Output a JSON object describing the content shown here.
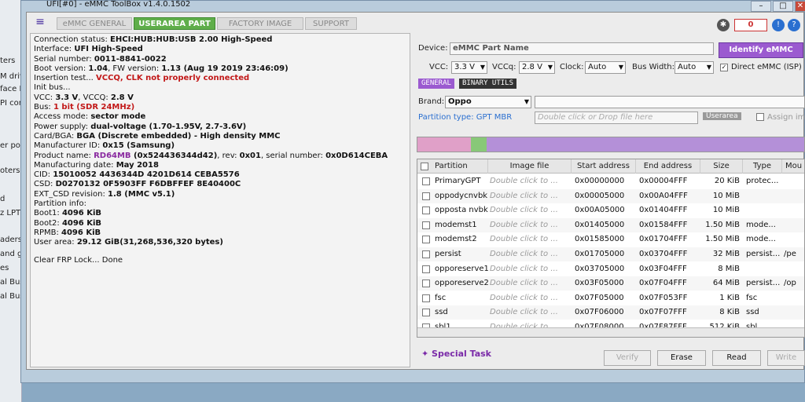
{
  "window": {
    "title": "UFI[#0] - eMMC ToolBox v1.4.0.1502",
    "controls": [
      "–",
      "□",
      "✕"
    ]
  },
  "background_fragments": [
    "ters",
    "M driv",
    "face D",
    "PI con",
    "er poi",
    "oters",
    "d",
    "z LPT)",
    "aders",
    "and g",
    "es",
    "al Bus",
    "al Bus"
  ],
  "tabs": [
    "eMMC GENERAL",
    "USERAREA PART",
    "FACTORY IMAGE",
    "SUPPORT"
  ],
  "counter": "0",
  "log": {
    "connection_status": {
      "label": "Connection status: ",
      "value": "EHCI:HUB:HUB:USB 2.00 High-Speed"
    },
    "interface": {
      "label": "Interface: ",
      "value": "UFI High-Speed"
    },
    "serial": {
      "label": "Serial number: ",
      "value": "0011-8841-0022"
    },
    "boot_version": {
      "label": "Boot version: ",
      "value": "1.04",
      "fw_label": ", FW version: ",
      "fw_value": "1.13 (Aug 19 2019 23:46:09)"
    },
    "insertion": {
      "label": "Insertion test... ",
      "value": "VCCQ, CLK not properly connected"
    },
    "init_bus": "Init bus...",
    "vcc": {
      "label": "VCC: ",
      "value": "3.3 V",
      "vccq_label": ", VCCQ: ",
      "vccq_value": "2.8 V"
    },
    "bus": {
      "label": "Bus: ",
      "value": "1 bit (SDR 24MHz)"
    },
    "access_mode": {
      "label": "Access mode: ",
      "value": "sector mode"
    },
    "power_supply": {
      "label": "Power supply: ",
      "value": "dual-voltage (1.70-1.95V, 2.7-3.6V)"
    },
    "card_bga": {
      "label": "Card/BGA: ",
      "value": "BGA (Discrete embedded) - High density MMC"
    },
    "manufacturer": {
      "label": "Manufacturer ID: ",
      "value": "0x15 (Samsung)"
    },
    "product": {
      "label": "Product name: ",
      "value": "RD64MB",
      "value2": " (0x524436344d42)",
      "rev_label": ", rev: ",
      "rev_value": "0x01",
      "sn_label": ", serial number: ",
      "sn_value": "0x0D614CEBA"
    },
    "mfg_date": {
      "label": "Manufacturing date: ",
      "value": "May 2018"
    },
    "cid": {
      "label": "CID: ",
      "value": "15010052 4436344D 4201D614 CEBA5576"
    },
    "csd": {
      "label": "CSD: ",
      "value": "D0270132 0F5903FF F6DBFFEF 8E40400C"
    },
    "ext_csd": {
      "label": "EXT_CSD revision: ",
      "value": "1.8 (MMC v5.1)"
    },
    "partition_info": "Partition info:",
    "boot1": {
      "label": "Boot1: ",
      "value": "4096 KiB"
    },
    "boot2": {
      "label": "Boot2: ",
      "value": "4096 KiB"
    },
    "rpmb": {
      "label": "RPMB: ",
      "value": "4096 KiB"
    },
    "user_area": {
      "label": "User area: ",
      "value": "29.12 GiB(31,268,536,320 bytes)"
    },
    "frp": "Clear FRP Lock... Done"
  },
  "device": {
    "label": "Device:",
    "value": "eMMC Part Name",
    "identify_button": "Identify eMMC",
    "vcc_label": "VCC:",
    "vcc_value": "3.3 V",
    "vccq_label": "VCCq:",
    "vccq_value": "2.8 V",
    "clock_label": "Clock:",
    "clock_value": "Auto",
    "buswidth_label": "Bus Width:",
    "buswidth_value": "Auto",
    "direct_label": "Direct eMMC (ISP)",
    "direct_checked": "✓"
  },
  "subtabs": [
    "GENERAL",
    "BINARY UTILS"
  ],
  "brand": {
    "label": "Brand:",
    "value": "Oppo"
  },
  "partition_type": {
    "label": "Partition type: GPT MBR",
    "drop_hint": "Double click or Drop file here",
    "userarea_label": "Userarea",
    "assign_label": "Assign ima"
  },
  "table": {
    "headers": [
      "Partition",
      "Image file",
      "Start address",
      "End address",
      "Size",
      "Type",
      "Mou"
    ],
    "rows": [
      {
        "name": "PrimaryGPT",
        "image": "Double click to ...",
        "start": "0x00000000",
        "end": "0x00004FFF",
        "size": "20 KiB",
        "type": "protec...",
        "mount": ""
      },
      {
        "name": "oppodycnvbk",
        "image": "Double click to ...",
        "start": "0x00005000",
        "end": "0x00A04FFF",
        "size": "10 MiB",
        "type": "",
        "mount": ""
      },
      {
        "name": "opposta nvbk",
        "image": "Double click to ...",
        "start": "0x00A05000",
        "end": "0x01404FFF",
        "size": "10 MiB",
        "type": "",
        "mount": ""
      },
      {
        "name": "modemst1",
        "image": "Double click to ...",
        "start": "0x01405000",
        "end": "0x01584FFF",
        "size": "1.50 MiB",
        "type": "mode...",
        "mount": ""
      },
      {
        "name": "modemst2",
        "image": "Double click to ...",
        "start": "0x01585000",
        "end": "0x01704FFF",
        "size": "1.50 MiB",
        "type": "mode...",
        "mount": ""
      },
      {
        "name": "persist",
        "image": "Double click to ...",
        "start": "0x01705000",
        "end": "0x03704FFF",
        "size": "32 MiB",
        "type": "persist...",
        "mount": "/pe"
      },
      {
        "name": "opporeserve1",
        "image": "Double click to ...",
        "start": "0x03705000",
        "end": "0x03F04FFF",
        "size": "8 MiB",
        "type": "",
        "mount": ""
      },
      {
        "name": "opporeserve2",
        "image": "Double click to ...",
        "start": "0x03F05000",
        "end": "0x07F04FFF",
        "size": "64 MiB",
        "type": "persist...",
        "mount": "/op"
      },
      {
        "name": "fsc",
        "image": "Double click to ...",
        "start": "0x07F05000",
        "end": "0x07F053FF",
        "size": "1 KiB",
        "type": "fsc",
        "mount": ""
      },
      {
        "name": "ssd",
        "image": "Double click to ...",
        "start": "0x07F06000",
        "end": "0x07F07FFF",
        "size": "8 KiB",
        "type": "ssd",
        "mount": ""
      },
      {
        "name": "sbl1",
        "image": "Double click to ...",
        "start": "0x07F08000",
        "end": "0x07F87FFF",
        "size": "512 KiB",
        "type": "sbl",
        "mount": ""
      }
    ]
  },
  "special_task": "Special Task",
  "buttons": {
    "verify": "Verify",
    "erase": "Erase",
    "read": "Read",
    "write": "Write"
  },
  "colors": {
    "accent_purple": "#9b5ad0",
    "active_tab": "#5fae4a",
    "error_red": "#c21818"
  }
}
